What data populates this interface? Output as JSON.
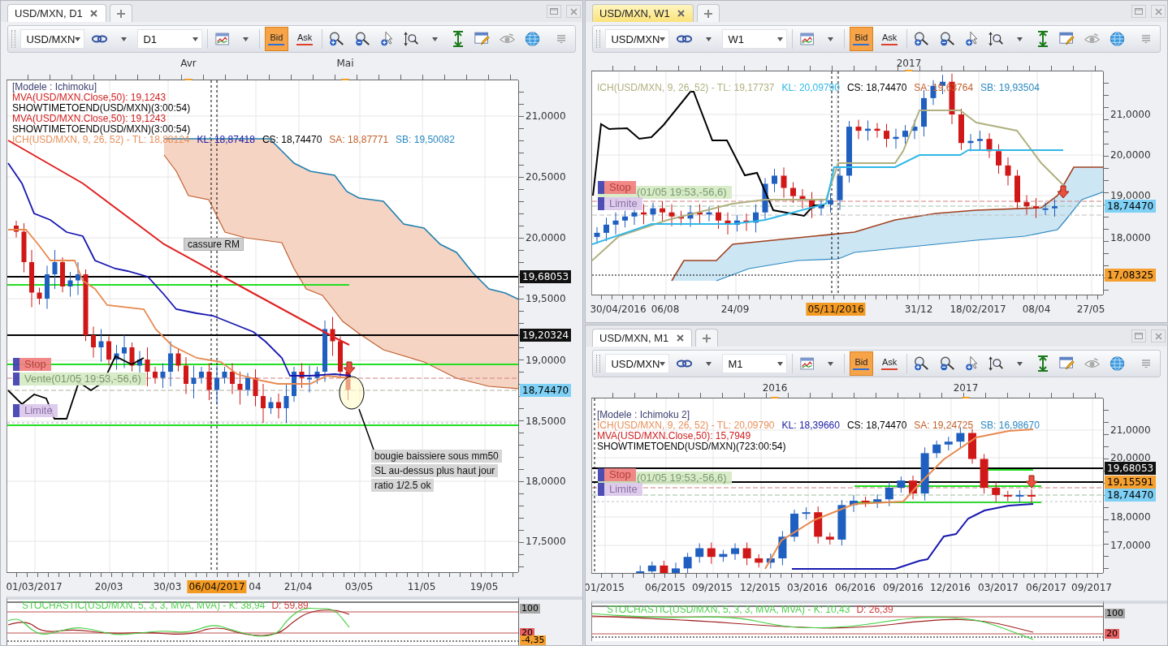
{
  "panels": [
    {
      "tab": {
        "label": "USD/MXN, D1",
        "focused": false
      },
      "toolbar": {
        "symbol": "USD/MXN",
        "timeframe": "D1",
        "price_sides": [
          {
            "label": "Bid",
            "selected": true,
            "color": "#2f6fd8"
          },
          {
            "label": "Ask",
            "selected": false,
            "color": "#e0402a"
          }
        ]
      },
      "time_labels": [
        "Avr",
        "Mai"
      ],
      "legend": [
        [
          {
            "text": "[Modele : Ichimoku]",
            "color": "#3c4070"
          }
        ],
        [
          {
            "text": "MVA(USD/MXN.Close,50): 19,1243",
            "color": "#d02020"
          }
        ],
        [
          {
            "text": "SHOWTIMETOEND(USD/MXN)(3:00:54)",
            "color": "#000000"
          }
        ],
        [
          {
            "text": "MVA(USD/MXN.Close,50): 19,1243",
            "color": "#d02020"
          }
        ],
        [
          {
            "text": "SHOWTIMETOEND(USD/MXN)(3:00:54)",
            "color": "#000000"
          }
        ],
        [
          {
            "text": "ICH(USD/MXN, 9, 26, 52) -  TL: 18,88124",
            "color": "#e8905a"
          },
          {
            "text": "KL: 18,87418",
            "color": "#2020a8"
          },
          {
            "text": "CS: 18,74470",
            "color": "#000000"
          },
          {
            "text": "SA: 18,87771",
            "color": "#c0602a"
          },
          {
            "text": "SB: 19,50082",
            "color": "#2a88c0"
          }
        ]
      ],
      "orders": [
        {
          "kind": "stop",
          "label": "Stop"
        },
        {
          "kind": "position",
          "label": "Vente(01/05 19:53,-56,6)"
        },
        {
          "kind": "limit",
          "label": "Limite"
        }
      ],
      "notes": [
        {
          "kind": "label",
          "lines": [
            "cassure RM"
          ]
        },
        {
          "kind": "callout",
          "lines": [
            "bougie baissiere sous mm50",
            "SL au-dessus plus haut jour",
            "ratio 1/2.5 ok"
          ]
        }
      ],
      "price_labels": [
        "21,0000",
        "20,5000",
        "20,0000",
        "19,5000",
        "19,0000",
        "18,5000",
        "18,0000",
        "17,5000"
      ],
      "price_tags": [
        {
          "text": "19,68053",
          "color": "#111111"
        },
        {
          "text": "19,20324",
          "color": "#111111"
        },
        {
          "text": "18,74470",
          "color": "#7fd0f5"
        }
      ],
      "date_labels": [
        {
          "text": "01/03/2017",
          "highlighted": false
        },
        {
          "text": "20/03",
          "highlighted": false
        },
        {
          "text": "30/03",
          "highlighted": false
        },
        {
          "text": "06/04/2017",
          "highlighted": true
        },
        {
          "text": "04",
          "highlighted": false
        },
        {
          "text": "21/04",
          "highlighted": false
        },
        {
          "text": "03/05",
          "highlighted": false
        },
        {
          "text": "11/05",
          "highlighted": false
        },
        {
          "text": "19/05",
          "highlighted": false
        }
      ],
      "oscillator": {
        "legend": [
          {
            "text": "STOCHASTIC(USD/MXN, 5, 3, 3, MVA, MVA) -  K: 38,94",
            "color": "#50d050"
          },
          {
            "text": "D: 59,89",
            "color": "#d04040"
          }
        ],
        "scale_tags": [
          {
            "text": "100",
            "color": "#a8a8a8"
          },
          {
            "text": "20",
            "color": "#e86060"
          },
          {
            "text": "-4,35",
            "color": "#f5a030"
          }
        ]
      }
    },
    {
      "tab": {
        "label": "USD/MXN, W1",
        "focused": true
      },
      "toolbar": {
        "symbol": "USD/MXN",
        "timeframe": "W1",
        "price_sides": [
          {
            "label": "Bid",
            "selected": true,
            "color": "#2f6fd8"
          },
          {
            "label": "Ask",
            "selected": false,
            "color": "#e0402a"
          }
        ]
      },
      "time_labels": [
        "2017"
      ],
      "legend": [
        [
          {
            "text": "ICH(USD/MXN, 9, 26, 52) -  TL: 19,17737",
            "color": "#b0b080"
          },
          {
            "text": "KL: 20,09790",
            "color": "#30b8e8"
          },
          {
            "text": "CS: 18,74470",
            "color": "#000000"
          },
          {
            "text": "SA: 19,63764",
            "color": "#c0602a"
          },
          {
            "text": "SB: 19,93504",
            "color": "#2a88c0"
          }
        ]
      ],
      "orders": [
        {
          "kind": "stop",
          "label": "Stop"
        },
        {
          "kind": "position",
          "label": "(01/05 19:53,-56,6)"
        },
        {
          "kind": "limit",
          "label": "Limite"
        }
      ],
      "price_labels": [
        "21,0000",
        "20,0000",
        "19,0000",
        "18,0000"
      ],
      "price_tags": [
        {
          "text": "18,74470",
          "color": "#7fd0f5"
        },
        {
          "text": "17,08325",
          "color": "#f5a030"
        }
      ],
      "date_labels": [
        {
          "text": "30/04/2016",
          "highlighted": false
        },
        {
          "text": "06/08",
          "highlighted": false
        },
        {
          "text": "24/09",
          "highlighted": false
        },
        {
          "text": "05/11/2016",
          "highlighted": true
        },
        {
          "text": "31/12",
          "highlighted": false
        },
        {
          "text": "18/02/2017",
          "highlighted": false
        },
        {
          "text": "08/04",
          "highlighted": false
        },
        {
          "text": "27/05",
          "highlighted": false
        }
      ]
    },
    {
      "tab": {
        "label": "USD/MXN, M1",
        "focused": false
      },
      "toolbar": {
        "symbol": "USD/MXN",
        "timeframe": "M1",
        "price_sides": [
          {
            "label": "Bid",
            "selected": true,
            "color": "#2f6fd8"
          },
          {
            "label": "Ask",
            "selected": false,
            "color": "#e0402a"
          }
        ]
      },
      "time_labels": [
        "2016",
        "2017"
      ],
      "legend": [
        [
          {
            "text": "[Modele : Ichimoku 2]",
            "color": "#3c4070"
          }
        ],
        [
          {
            "text": "ICH(USD/MXN, 9, 26, 52) -  TL: 20,09790",
            "color": "#e8905a"
          },
          {
            "text": "KL: 18,39660",
            "color": "#2020a8"
          },
          {
            "text": "CS: 18,74470",
            "color": "#000000"
          },
          {
            "text": "SA: 19,24725",
            "color": "#c0602a"
          },
          {
            "text": "SB: 16,98670",
            "color": "#2a88c0"
          }
        ],
        [
          {
            "text": "MVA(USD/MXN.Close,50): 15,7949",
            "color": "#d02020"
          }
        ],
        [
          {
            "text": "SHOWTIMETOEND(USD/MXN)(723:00:54)",
            "color": "#000000"
          }
        ]
      ],
      "orders": [
        {
          "kind": "stop",
          "label": "Stop"
        },
        {
          "kind": "position",
          "label": "(01/05 19:53,-56,6)"
        },
        {
          "kind": "limit",
          "label": "Limite"
        }
      ],
      "price_labels": [
        "21,0000",
        "20,0000",
        "18,0000",
        "17,0000"
      ],
      "price_tags": [
        {
          "text": "19,68053",
          "color": "#111111"
        },
        {
          "text": "19,15591",
          "color": "#f5a030"
        },
        {
          "text": "18,74470",
          "color": "#7fd0f5"
        }
      ],
      "date_labels": [
        {
          "text": "01/2015",
          "highlighted": false
        },
        {
          "text": "06/2015",
          "highlighted": false
        },
        {
          "text": "09/2015",
          "highlighted": false
        },
        {
          "text": "12/2015",
          "highlighted": false
        },
        {
          "text": "03/2016",
          "highlighted": false
        },
        {
          "text": "06/2016",
          "highlighted": false
        },
        {
          "text": "09/2016",
          "highlighted": false
        },
        {
          "text": "12/2016",
          "highlighted": false
        },
        {
          "text": "03/2017",
          "highlighted": false
        },
        {
          "text": "06/2017",
          "highlighted": false
        },
        {
          "text": "09/2017",
          "highlighted": false
        }
      ],
      "oscillator": {
        "legend": [
          {
            "text": "STOCHASTIC(USD/MXN, 5, 3, 3, MVA, MVA) -  K: 10,43",
            "color": "#50d050"
          },
          {
            "text": "D: 26,39",
            "color": "#d04040"
          }
        ],
        "scale_tags": [
          {
            "text": "100",
            "color": "#a8a8a8"
          },
          {
            "text": "20",
            "color": "#e86060"
          }
        ]
      }
    }
  ]
}
